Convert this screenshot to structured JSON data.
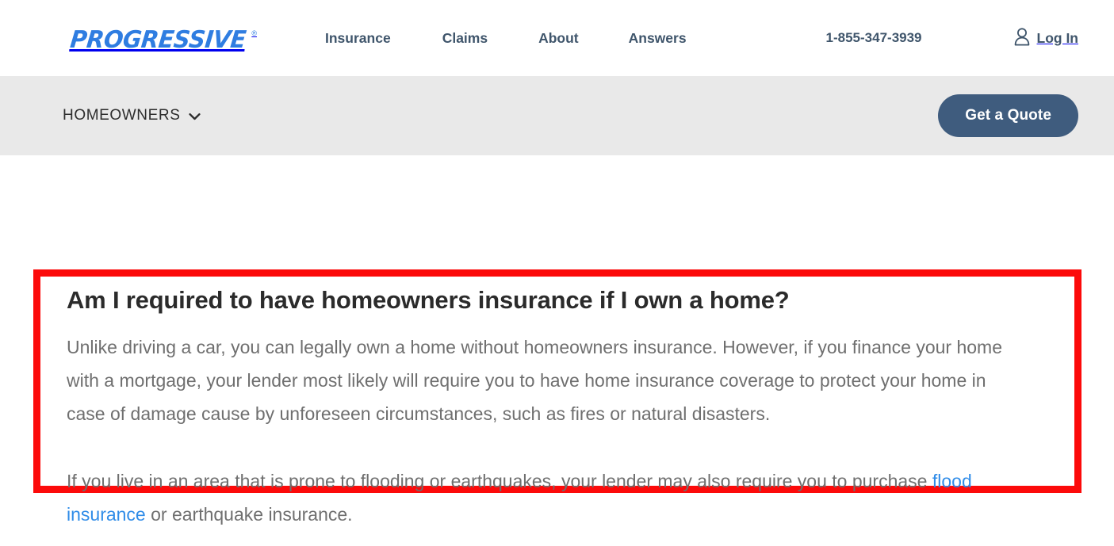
{
  "header": {
    "logo": {
      "text": "PROGRESSIVE",
      "trademark": "®",
      "color": "#2f7de1"
    },
    "nav": [
      {
        "label": "Insurance"
      },
      {
        "label": "Claims"
      },
      {
        "label": "About"
      },
      {
        "label": "Answers"
      }
    ],
    "phone": "1-855-347-3939",
    "login": {
      "label": "Log In",
      "icon": "person-icon"
    }
  },
  "subheader": {
    "product": "HOMEOWNERS",
    "product_icon": "chevron-down-icon",
    "quote_button": "Get a Quote",
    "background": "#e9e9e9",
    "button_color": "#3f5c7e"
  },
  "article": {
    "heading": "Am I required to have homeowners insurance if I own a home?",
    "paragraph_1": "Unlike driving a car, you can legally own a home without homeowners insurance. However, if you finance your home with a mortgage, your lender most likely will require you to have home insurance coverage to protect your home in case of damage cause by unforeseen circumstances, such as fires or natural disasters.",
    "paragraph_2_before": "If you live in an area that is prone to flooding or earthquakes, your lender may also require you to purchase ",
    "paragraph_2_link": "flood insurance",
    "paragraph_2_after": " or earthquake insurance.",
    "link_color": "#2f8ce8"
  },
  "annotation": {
    "highlight_color": "#fc0a0a"
  }
}
